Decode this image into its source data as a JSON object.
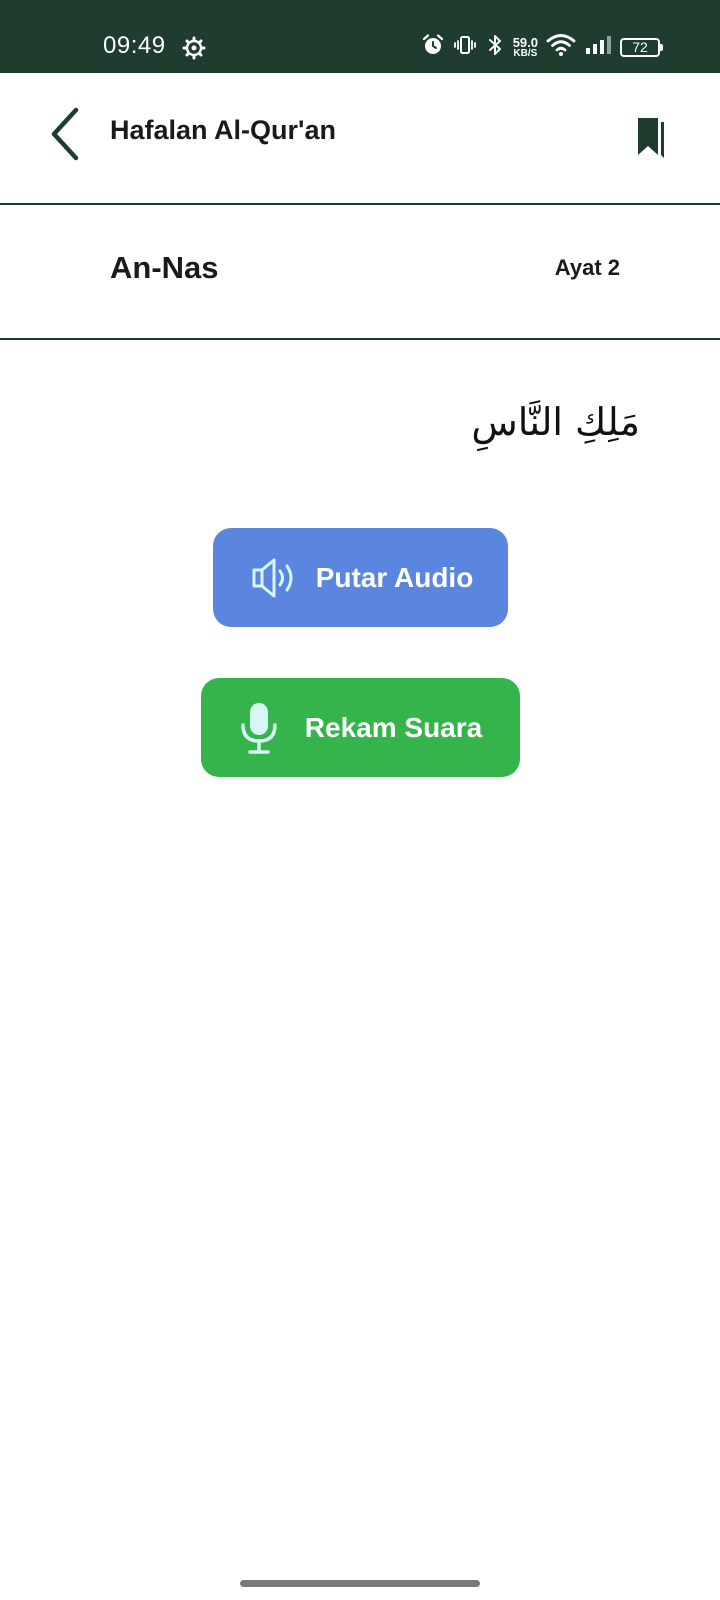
{
  "status_bar": {
    "time": "09:49",
    "net_speed_value": "59.0",
    "net_speed_unit": "KB/S",
    "battery": "72",
    "icons": [
      "settings-icon",
      "alarm-icon",
      "vibrate-icon",
      "bluetooth-icon",
      "wifi-icon",
      "signal-icon",
      "battery-icon"
    ]
  },
  "app_bar": {
    "title": "Hafalan Al-Qur'an",
    "back_icon": "chevron-left-icon",
    "bookmark_icon": "bookmark-icon"
  },
  "surah": {
    "name": "An-Nas",
    "ayat_label": "Ayat 2"
  },
  "verse": {
    "arabic": "مَلِكِ النَّاسِ"
  },
  "actions": {
    "play_audio_label": "Putar Audio",
    "record_label": "Rekam Suara",
    "play_audio_icon": "speaker-icon",
    "record_icon": "microphone-icon"
  },
  "colors": {
    "status_bar_bg": "#1e3d2f",
    "accent_dark_green": "#1e3d2f",
    "play_audio_bg": "#5b86e0",
    "record_bg": "#35b44c",
    "icon_light_cyan": "#d6f7f4"
  }
}
